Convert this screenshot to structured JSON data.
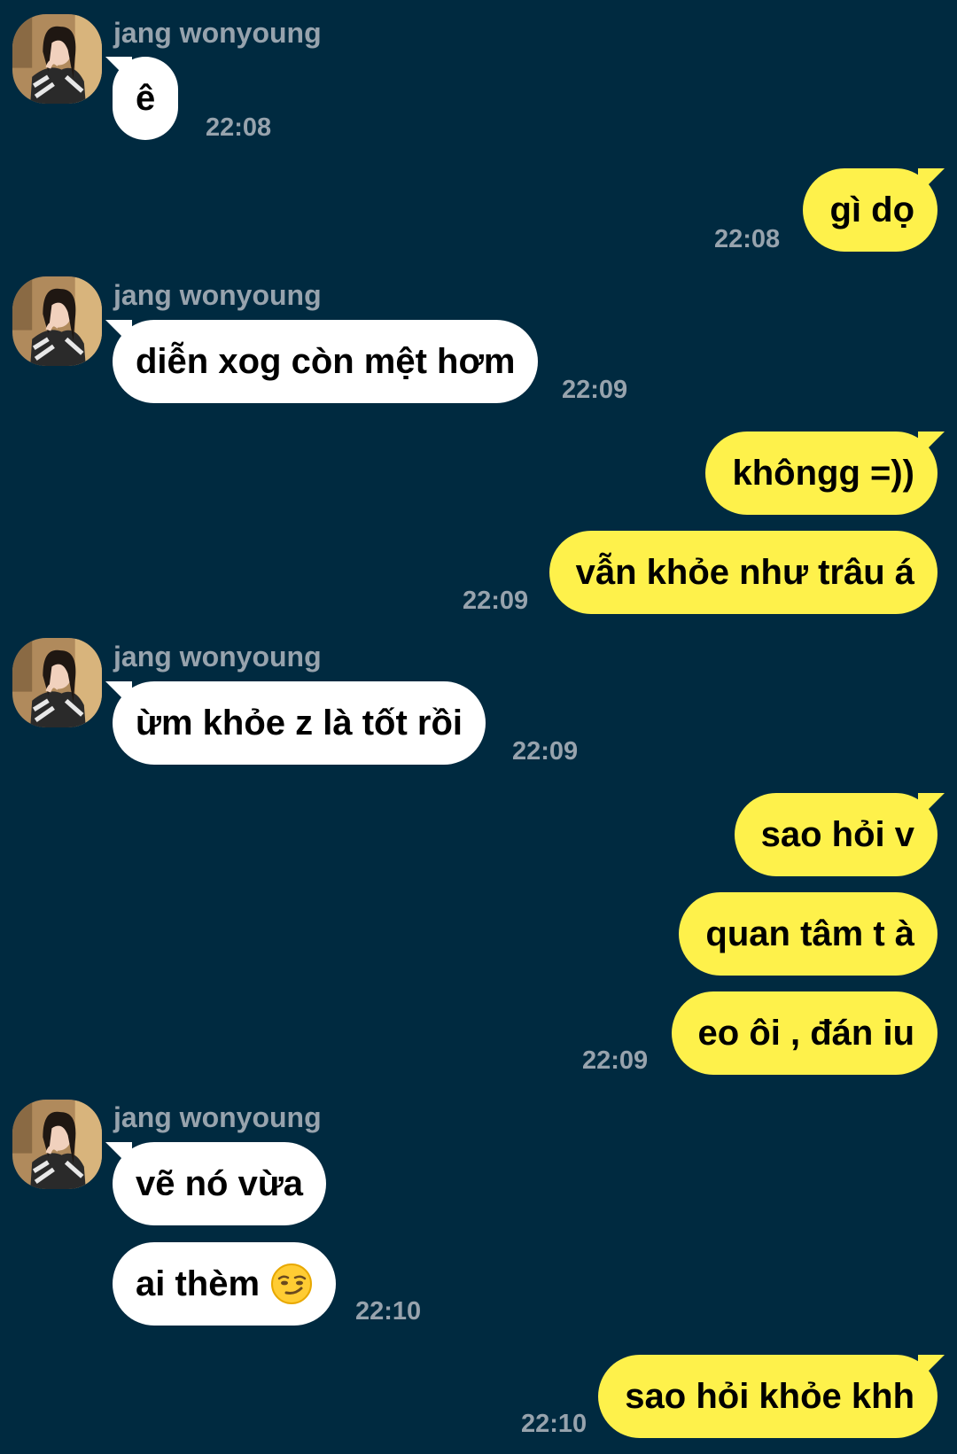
{
  "contact": {
    "name": "jang wonyoung"
  },
  "messages": [
    {
      "text": "ê",
      "time": "22:08"
    },
    {
      "text": "gì dọ",
      "time": "22:08"
    },
    {
      "text": "diễn xog còn mệt hơm",
      "time": "22:09"
    },
    {
      "text": "khôngg =))"
    },
    {
      "text": "vẫn khỏe như trâu á",
      "time": "22:09"
    },
    {
      "text": "ừm khỏe z là tốt rồi",
      "time": "22:09"
    },
    {
      "text": "sao hỏi v"
    },
    {
      "text": "quan tâm t à"
    },
    {
      "text": "eo ôi , đán iu",
      "time": "22:09"
    },
    {
      "text": "vẽ nó vừa"
    },
    {
      "text": "ai thèm",
      "emoji": "smirk-emoji",
      "time": "22:10"
    },
    {
      "text": "sao hỏi khỏe khh",
      "time": "22:10"
    }
  ],
  "colors": {
    "background": "#002a40",
    "incoming_bubble": "#ffffff",
    "outgoing_bubble": "#fef14b",
    "meta_text": "#97a3ad"
  }
}
